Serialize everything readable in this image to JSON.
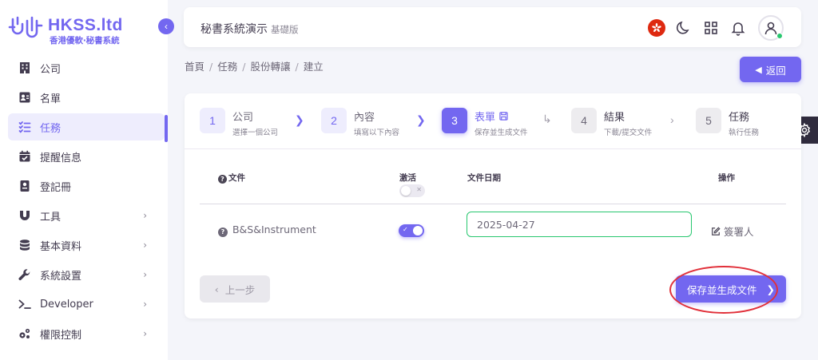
{
  "brand": {
    "title": "HKSS.ltd",
    "subtitle": "香港優軟‧秘書系統",
    "color": "#7367f0"
  },
  "sidebar": {
    "collapse_icon": "chevron-left-icon",
    "items": [
      {
        "label": "公司",
        "icon": "building-icon",
        "has_children": false,
        "active": false
      },
      {
        "label": "名單",
        "icon": "contact-card-icon",
        "has_children": false,
        "active": false
      },
      {
        "label": "任務",
        "icon": "task-list-icon",
        "has_children": false,
        "active": true
      },
      {
        "label": "提醒信息",
        "icon": "calendar-check-icon",
        "has_children": false,
        "active": false
      },
      {
        "label": "登記冊",
        "icon": "book-icon",
        "has_children": false,
        "active": false
      },
      {
        "label": "工具",
        "icon": "magnet-icon",
        "has_children": true,
        "active": false
      },
      {
        "label": "基本資料",
        "icon": "database-icon",
        "has_children": true,
        "active": false
      },
      {
        "label": "系統設置",
        "icon": "wrench-icon",
        "has_children": true,
        "active": false
      },
      {
        "label": "Developer",
        "icon": "terminal-icon",
        "has_children": true,
        "active": false
      },
      {
        "label": "權限控制",
        "icon": "cogs-icon",
        "has_children": true,
        "active": false
      }
    ]
  },
  "topbar": {
    "title": "秘書系統演示",
    "edition": "基礎版",
    "icons": [
      "hong-kong-flag-icon",
      "moon-icon",
      "apps-grid-icon",
      "bell-icon",
      "user-avatar-icon"
    ]
  },
  "breadcrumb": [
    "首頁",
    "任務",
    "股份轉讓",
    "建立"
  ],
  "back_button": {
    "label": "返回",
    "icon": "back-arrow-icon"
  },
  "stepper": [
    {
      "num": "1",
      "title": "公司",
      "sub": "選擇一個公司",
      "state": "done"
    },
    {
      "num": "2",
      "title": "內容",
      "sub": "填寫以下內容",
      "state": "done"
    },
    {
      "num": "3",
      "title": "表單",
      "sub": "保存並生成文件",
      "state": "current",
      "icon": "save-icon"
    },
    {
      "num": "4",
      "title": "結果",
      "sub": "下載/提交文件",
      "state": "future"
    },
    {
      "num": "5",
      "title": "任務",
      "sub": "執行任務",
      "state": "future"
    }
  ],
  "table": {
    "headers": {
      "file": "文件",
      "active": "激活",
      "date": "文件日期",
      "action": "操作"
    },
    "rows": [
      {
        "file": "B&S&Instrument",
        "active": true,
        "date": "2025-04-27",
        "action": "簽署人"
      }
    ]
  },
  "buttons": {
    "prev": "上一步",
    "save": "保存並生成文件"
  },
  "colors": {
    "primary": "#7367f0",
    "success": "#28c76f",
    "highlight": "#e1303a",
    "dark": "#2f2b3d"
  }
}
